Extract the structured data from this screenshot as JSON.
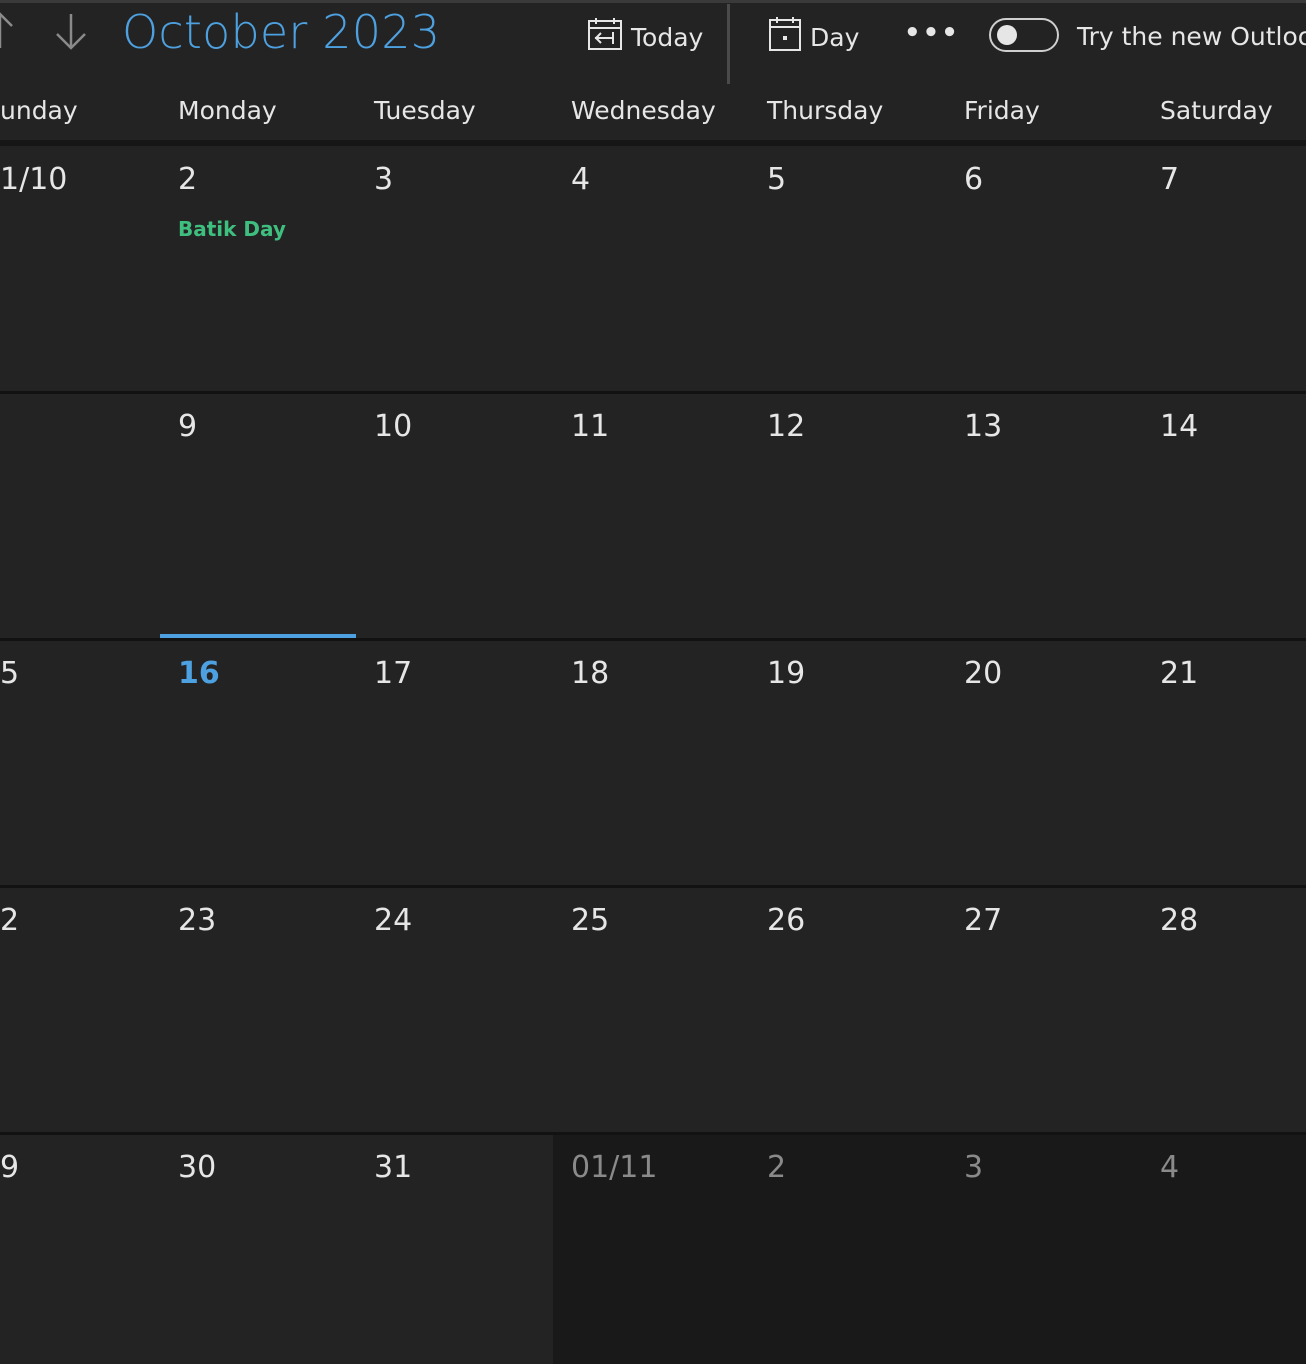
{
  "toolbar": {
    "month_title": "October 2023",
    "today_label": "Today",
    "view_label": "Day",
    "more_label": "•••",
    "toggle_label": "Try the new Outlook"
  },
  "colors": {
    "accent": "#4ea1e0",
    "event": "#3fbf7f",
    "background": "#232323",
    "other_month_background": "#191919"
  },
  "day_headers": [
    "unday",
    "Monday",
    "Tuesday",
    "Wednesday",
    "Thursday",
    "Friday",
    "Saturday"
  ],
  "weeks": [
    [
      {
        "label": "1/10"
      },
      {
        "label": "2",
        "events": [
          "Batik Day"
        ]
      },
      {
        "label": "3"
      },
      {
        "label": "4"
      },
      {
        "label": "5"
      },
      {
        "label": "6"
      },
      {
        "label": "7"
      }
    ],
    [
      {
        "label": ""
      },
      {
        "label": "9"
      },
      {
        "label": "10"
      },
      {
        "label": "11"
      },
      {
        "label": "12"
      },
      {
        "label": "13"
      },
      {
        "label": "14"
      }
    ],
    [
      {
        "label": "5"
      },
      {
        "label": "16",
        "today": true
      },
      {
        "label": "17"
      },
      {
        "label": "18"
      },
      {
        "label": "19"
      },
      {
        "label": "20"
      },
      {
        "label": "21"
      }
    ],
    [
      {
        "label": "2"
      },
      {
        "label": "23"
      },
      {
        "label": "24"
      },
      {
        "label": "25"
      },
      {
        "label": "26"
      },
      {
        "label": "27"
      },
      {
        "label": "28"
      }
    ],
    [
      {
        "label": "9"
      },
      {
        "label": "30"
      },
      {
        "label": "31"
      },
      {
        "label": "01/11",
        "other_month": true
      },
      {
        "label": "2",
        "other_month": true
      },
      {
        "label": "3",
        "other_month": true
      },
      {
        "label": "4",
        "other_month": true
      }
    ]
  ]
}
